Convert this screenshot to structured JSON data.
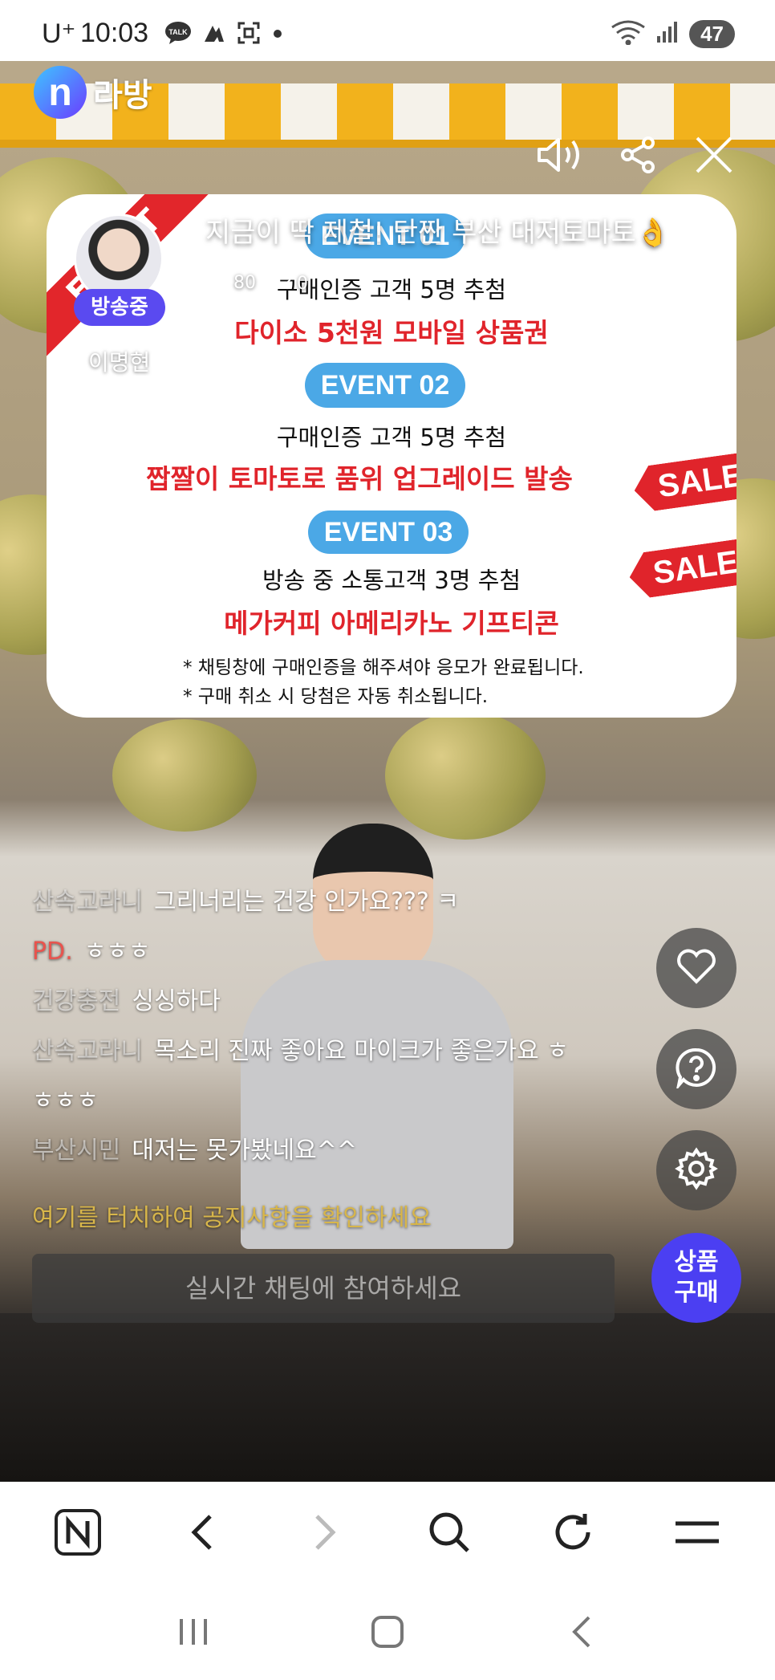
{
  "status_bar": {
    "carrier": "U⁺",
    "time": "10:03",
    "battery": "47",
    "notification_icons": [
      "talk-icon",
      "app-icon",
      "screenshot-icon",
      "dot-icon"
    ],
    "system_icons": [
      "wifi-icon",
      "signal-icon"
    ]
  },
  "header": {
    "logo_letter": "n",
    "logo_text": "라방"
  },
  "broadcast": {
    "title": "지금이 딱 제철! 단짠 부산 대저토마토👌",
    "views": "80",
    "likes": "0",
    "live_badge": "방송중",
    "host_name": "이명현"
  },
  "banner": {
    "ribbon": "EVENT",
    "events": [
      {
        "label": "EVENT 01",
        "sub": "구매인증 고객 5명 추첨",
        "prize": "다이소 5천원 모바일 상품권"
      },
      {
        "label": "EVENT 02",
        "sub": "구매인증 고객 5명 추첨",
        "prize": "짭짤이 토마토로 품위 업그레이드 발송"
      },
      {
        "label": "EVENT 03",
        "sub": "방송 중 소통고객 3명 추첨",
        "prize": "메가커피 아메리카노 기프티콘"
      }
    ],
    "notes": [
      "* 채팅창에 구매인증을 해주셔야 응모가 완료됩니다.",
      "* 구매 취소 시 당첨은 자동 취소됩니다."
    ],
    "sale_tag": "SALE"
  },
  "chat": {
    "messages": [
      {
        "nick": "산속고라니",
        "msg": "그리너리는 건강 인가요??? ㅋ"
      },
      {
        "nick": "PD.",
        "msg": "ㅎㅎㅎ"
      },
      {
        "nick": "건강충전",
        "msg": "싱싱하다"
      },
      {
        "nick": "산속고라니",
        "msg": "목소리 진짜 좋아요 마이크가 좋은가요 ㅎ"
      },
      {
        "nick": "",
        "msg": "ㅎㅎㅎ"
      },
      {
        "nick": "부산시민",
        "msg": "대저는 못가봤네요^^"
      }
    ],
    "notice": "여기를 터치하여 공지사항을 확인하세요",
    "input_placeholder": "실시간 채팅에 참여하세요"
  },
  "side_buttons": {
    "buy_line1": "상품",
    "buy_line2": "구매"
  },
  "colors": {
    "brand_purple": "#4b3ff2",
    "event_blue": "#4ba8e6",
    "event_red": "#e0242b",
    "pd_nick": "#e8544e",
    "notice_gold": "#d8b64a"
  }
}
